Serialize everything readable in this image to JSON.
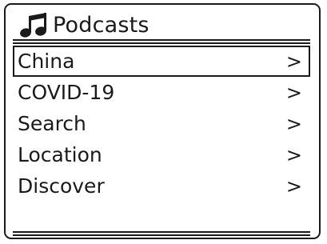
{
  "header": {
    "icon": "music-note-icon",
    "title": "Podcasts"
  },
  "menu": {
    "chevron": ">",
    "items": [
      {
        "label": "China",
        "selected": true
      },
      {
        "label": "COVID-19",
        "selected": false
      },
      {
        "label": "Search",
        "selected": false
      },
      {
        "label": "Location",
        "selected": false
      },
      {
        "label": "Discover",
        "selected": false
      }
    ]
  }
}
